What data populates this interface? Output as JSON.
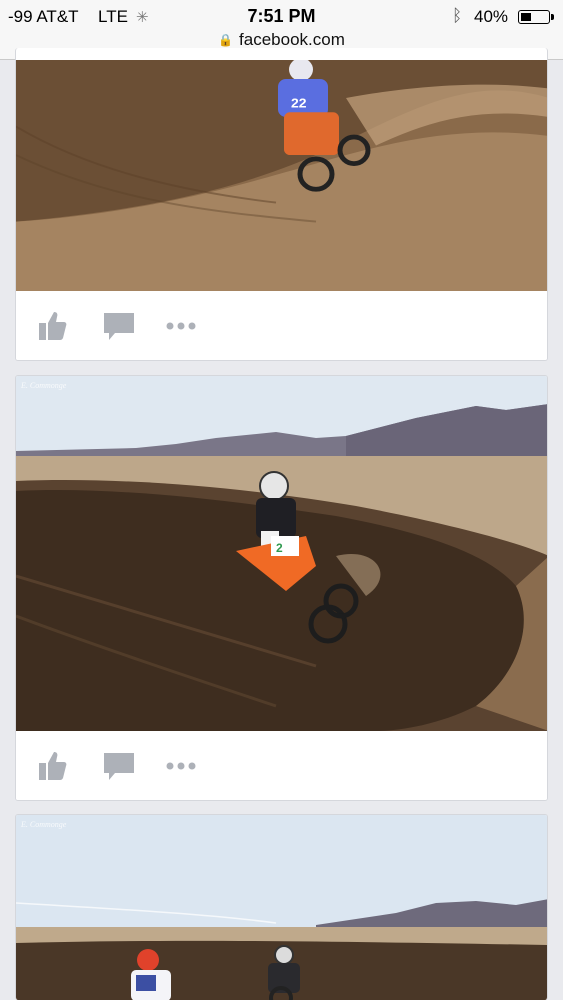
{
  "status_bar": {
    "carrier": "-99 AT&T",
    "network": "LTE",
    "time": "7:51 PM",
    "battery_percent": "40%",
    "battery_level": 0.4
  },
  "browser": {
    "url": "facebook.com"
  },
  "posts": [
    {
      "watermark": "",
      "actions": [
        "like-icon",
        "comment-icon",
        "more-icon"
      ]
    },
    {
      "watermark": "E. Commonge",
      "actions": [
        "like-icon",
        "comment-icon",
        "more-icon"
      ]
    },
    {
      "watermark": "E. Commonge"
    }
  ],
  "photo_labels": [
    "22",
    "2"
  ]
}
